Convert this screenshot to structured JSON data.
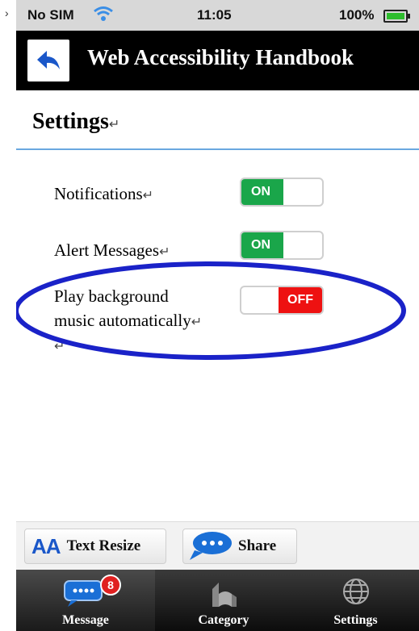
{
  "status_bar": {
    "carrier": "No SIM",
    "time": "11:05",
    "battery": "100%"
  },
  "header": {
    "title": "Web Accessibility Handbook"
  },
  "page": {
    "heading": "Settings"
  },
  "settings": [
    {
      "label": "Notifications",
      "state": "ON"
    },
    {
      "label": "Alert Messages",
      "state": "ON"
    },
    {
      "label_line1": "Play background",
      "label_line2": "music automatically",
      "state": "OFF"
    }
  ],
  "actions": {
    "text_resize_icon": "AA",
    "text_resize": "Text Resize",
    "share": "Share"
  },
  "tabs": [
    {
      "label": "Message",
      "badge": "8"
    },
    {
      "label": "Category"
    },
    {
      "label": "Settings"
    }
  ],
  "colors": {
    "on": "#1aa64a",
    "off": "#ee1111",
    "highlight": "#1a22c8",
    "accent": "#1a57c9"
  }
}
